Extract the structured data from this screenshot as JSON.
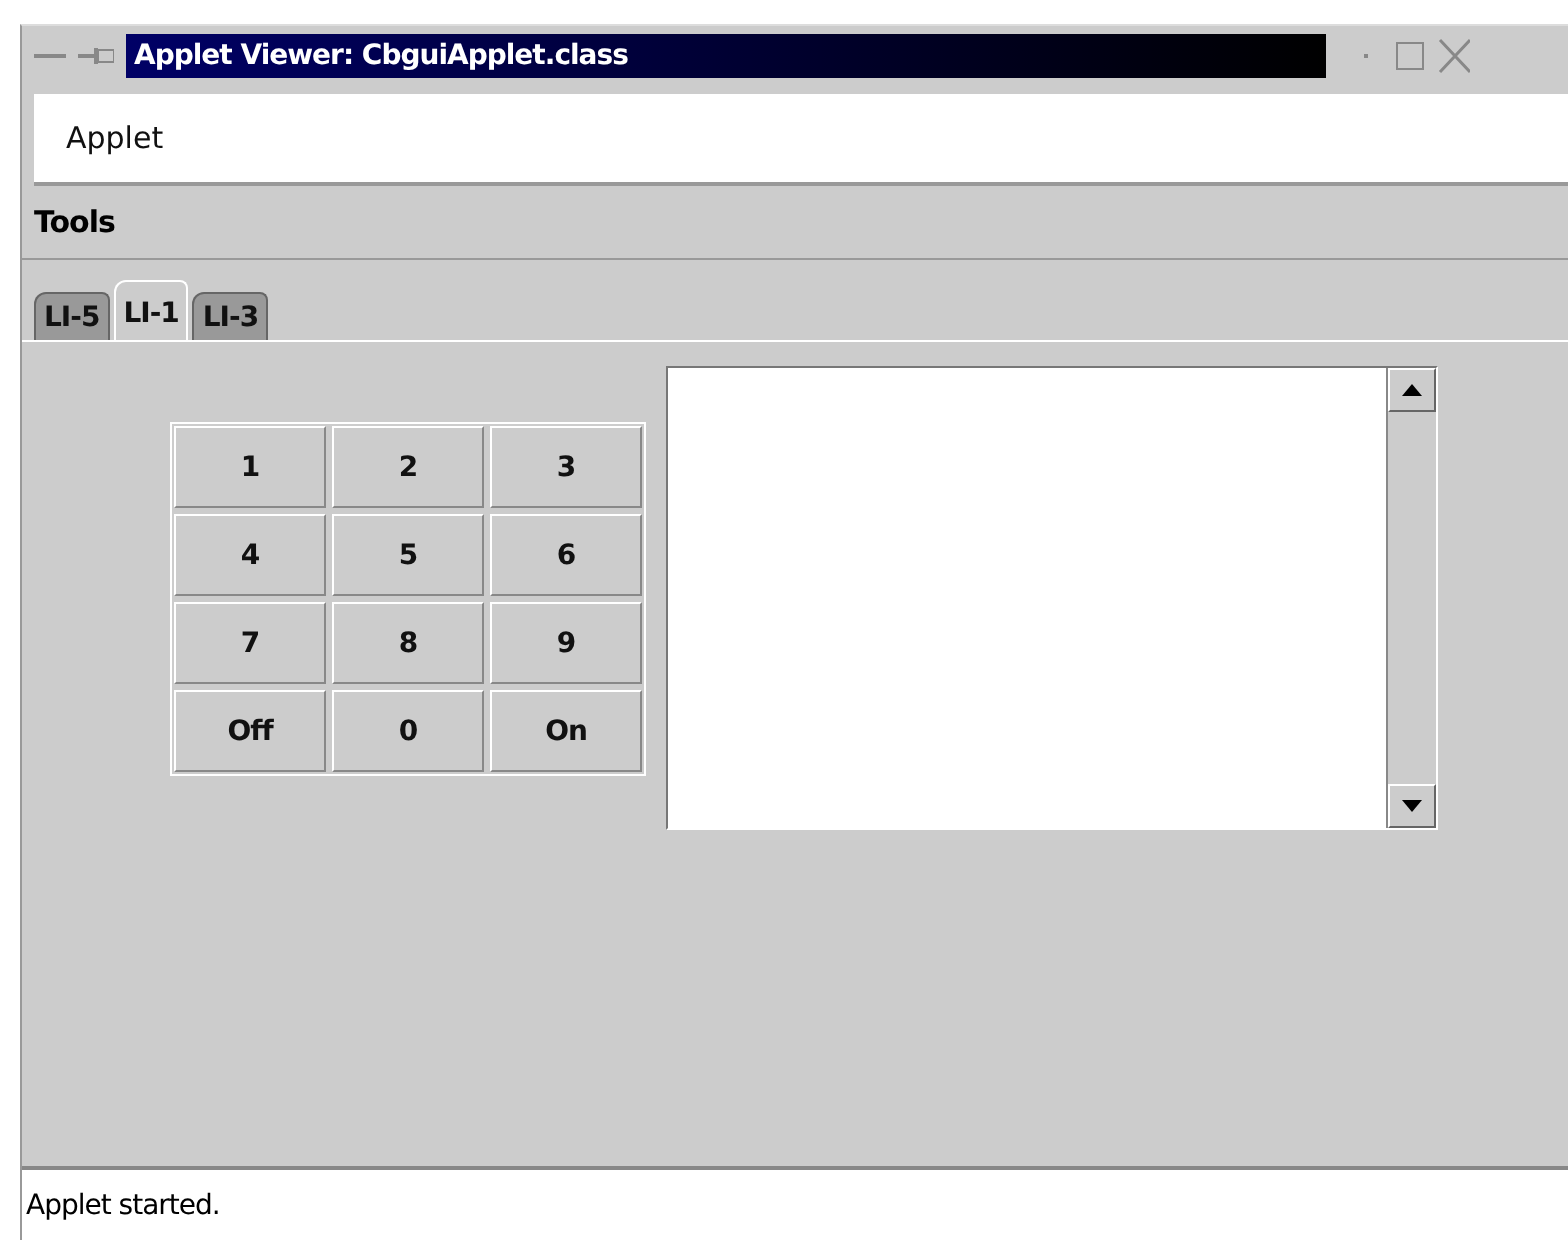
{
  "window": {
    "title": "Applet Viewer: CbguiApplet.class"
  },
  "menu_bar": {
    "items": [
      "Applet"
    ]
  },
  "toolbar": {
    "label": "Tools"
  },
  "tabs": [
    {
      "label": "LI-5",
      "selected": false
    },
    {
      "label": "LI-1",
      "selected": true
    },
    {
      "label": "LI-3",
      "selected": false
    }
  ],
  "keypad": {
    "keys": [
      "1",
      "2",
      "3",
      "4",
      "5",
      "6",
      "7",
      "8",
      "9",
      "Off",
      "0",
      "On"
    ]
  },
  "status_bar": {
    "text": "Applet started."
  }
}
